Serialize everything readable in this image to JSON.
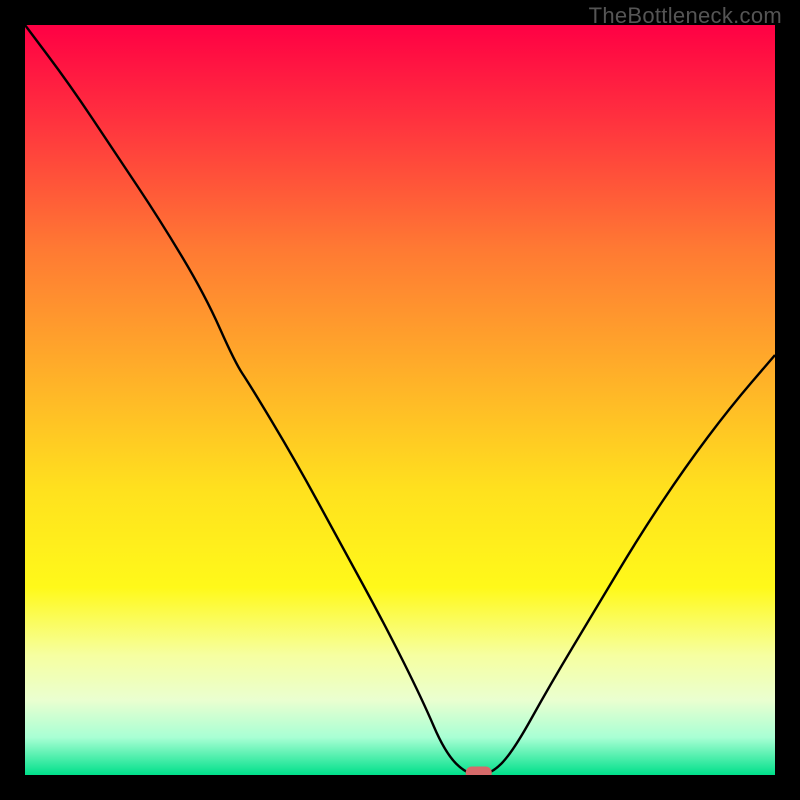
{
  "watermark": "TheBottleneck.com",
  "chart_data": {
    "type": "line",
    "title": "",
    "xlabel": "",
    "ylabel": "",
    "xlim": [
      0,
      100
    ],
    "ylim": [
      0,
      100
    ],
    "grid": false,
    "legend": false,
    "background_gradient": {
      "type": "vertical",
      "stops": [
        {
          "pos": 0.0,
          "color": "#ff0044"
        },
        {
          "pos": 0.12,
          "color": "#ff2f3f"
        },
        {
          "pos": 0.3,
          "color": "#ff7a33"
        },
        {
          "pos": 0.48,
          "color": "#ffb428"
        },
        {
          "pos": 0.62,
          "color": "#ffe11e"
        },
        {
          "pos": 0.75,
          "color": "#fff91a"
        },
        {
          "pos": 0.84,
          "color": "#f6ffa0"
        },
        {
          "pos": 0.9,
          "color": "#eaffd0"
        },
        {
          "pos": 0.95,
          "color": "#a8ffd4"
        },
        {
          "pos": 1.0,
          "color": "#00e08a"
        }
      ]
    },
    "series": [
      {
        "name": "bottleneck-curve",
        "color": "#000000",
        "x": [
          0,
          6,
          12,
          18,
          24,
          28,
          30,
          36,
          42,
          48,
          53,
          56,
          59,
          62,
          65,
          70,
          76,
          82,
          88,
          94,
          100
        ],
        "y": [
          100,
          92,
          83,
          74,
          64,
          55,
          52,
          42,
          31,
          20,
          10,
          3,
          0,
          0,
          3,
          12,
          22,
          32,
          41,
          49,
          56
        ]
      }
    ],
    "marker": {
      "name": "optimal-point",
      "x": 60.5,
      "y": 0,
      "color": "#d66a6a",
      "shape": "rounded-rect"
    }
  }
}
